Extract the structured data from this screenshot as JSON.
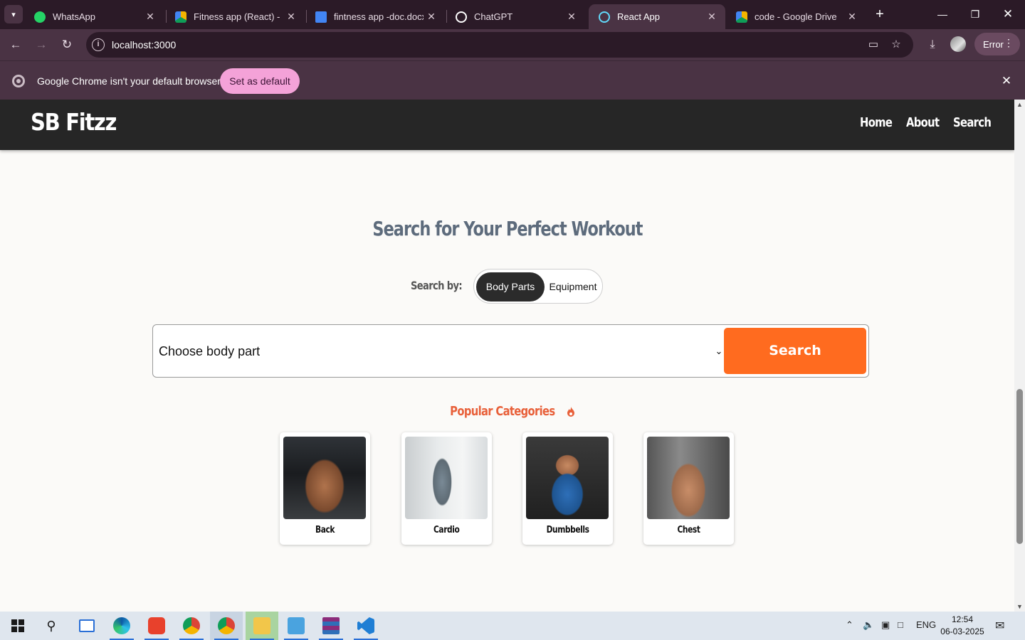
{
  "browser": {
    "tabs": [
      {
        "label": "WhatsApp",
        "icon": "whatsapp-icon",
        "color": "#25d366",
        "active": false
      },
      {
        "label": "Fitness app (React) - Ha",
        "icon": "google-drive-icon",
        "color": "#f4b400",
        "active": false
      },
      {
        "label": "fintness app -doc.docx",
        "icon": "google-docs-icon",
        "color": "#4285f4",
        "active": false
      },
      {
        "label": "ChatGPT",
        "icon": "chatgpt-icon",
        "color": "#ffffff",
        "active": false
      },
      {
        "label": "React App",
        "icon": "react-icon",
        "color": "#61dafb",
        "active": true
      },
      {
        "label": "code - Google Drive",
        "icon": "google-drive-icon",
        "color": "#f4b400",
        "active": false
      }
    ],
    "url": "localhost:3000",
    "error_label": "Error",
    "infobar": {
      "message": "Google Chrome isn't your default browser",
      "button": "Set as default"
    }
  },
  "site": {
    "brand": "SB Fitzz",
    "nav": [
      "Home",
      "About",
      "Search"
    ],
    "heading": "Search for Your Perfect Workout",
    "search_by_label": "Search by:",
    "toggle_options": [
      "Body Parts",
      "Equipment"
    ],
    "toggle_selected": "Body Parts",
    "select_value": "Choose body part",
    "search_button": "Search",
    "popular_heading": "Popular Categories",
    "categories": [
      {
        "label": "Back"
      },
      {
        "label": "Cardio"
      },
      {
        "label": "Dumbbells"
      },
      {
        "label": "Chest"
      }
    ],
    "accent_color": "#ff6b1f"
  },
  "taskbar": {
    "apps": [
      "start",
      "search",
      "task-view",
      "edge",
      "wps-office",
      "chrome",
      "chrome-profile",
      "file-explorer",
      "control-panel",
      "winrar",
      "vscode"
    ],
    "language": "ENG",
    "time": "12:54",
    "date": "06-03-2025"
  }
}
